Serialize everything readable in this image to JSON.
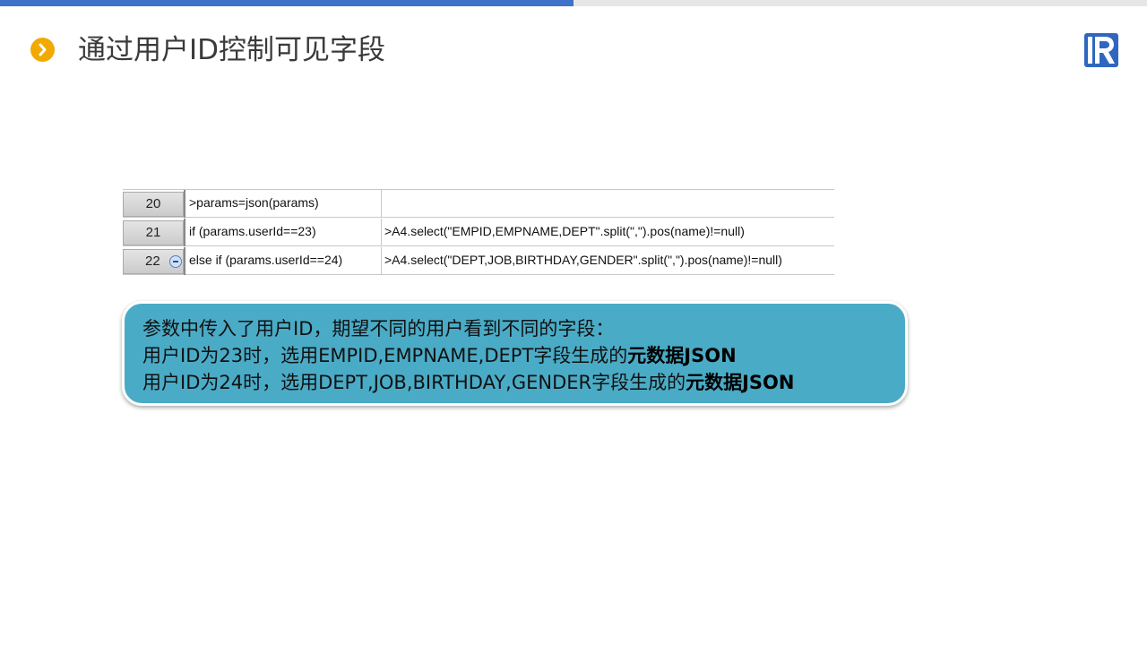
{
  "title": "通过用户ID控制可见字段",
  "colors": {
    "accent_bar": "#3f72c8",
    "title_icon": "#f2a900",
    "callout_bg": "#4aabc6",
    "logo": "#2f67c0"
  },
  "icons": {
    "title_icon": "chevron-right-icon",
    "logo": "r-logo-icon",
    "collapse": "minus-circle-icon"
  },
  "grid": {
    "rows": [
      {
        "num": "20",
        "a": ">params=json(params)",
        "b": ""
      },
      {
        "num": "21",
        "a": "if (params.userId==23)",
        "b": ">A4.select(\"EMPID,EMPNAME,DEPT\".split(\",\").pos(name)!=null)"
      },
      {
        "num": "22",
        "a": "else if (params.userId==24)",
        "b": ">A4.select(\"DEPT,JOB,BIRTHDAY,GENDER\".split(\",\").pos(name)!=null)"
      }
    ]
  },
  "callout": {
    "line1": "参数中传入了用户ID，期望不同的用户看到不同的字段：",
    "line2_text": "用户ID为23时，选用EMPID,EMPNAME,DEPT字段生成的",
    "line2_bold": "元数据JSON",
    "line3_text": "用户ID为24时，选用DEPT,JOB,BIRTHDAY,GENDER字段生成的",
    "line3_bold": "元数据JSON"
  }
}
